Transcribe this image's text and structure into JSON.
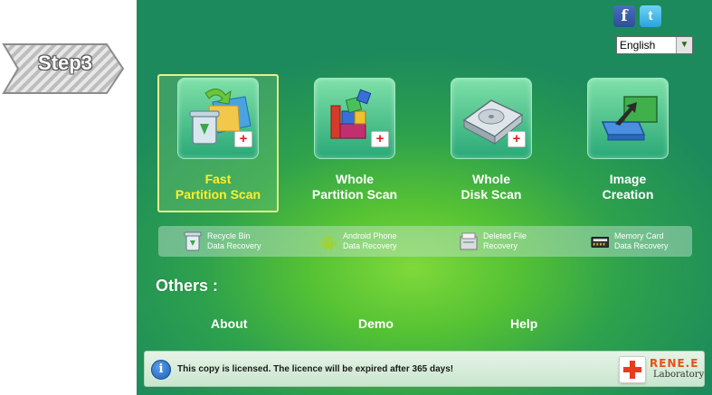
{
  "step_badge": {
    "label": "Step3"
  },
  "social": {
    "facebook": "f",
    "twitter": "t"
  },
  "language": {
    "selected": "English",
    "arrow": "▼"
  },
  "tiles": [
    {
      "line1": "Fast",
      "line2": "Partition Scan",
      "selected": true
    },
    {
      "line1": "Whole",
      "line2": "Partition Scan"
    },
    {
      "line1": "Whole",
      "line2": "Disk Scan"
    },
    {
      "line1": "Image",
      "line2": "Creation"
    }
  ],
  "recovery_bar": [
    {
      "line1": "Recycle Bin",
      "line2": "Data Recovery",
      "icon": "recycle-bin-icon"
    },
    {
      "line1": "Android Phone",
      "line2": "Data Recovery",
      "icon": "android-icon"
    },
    {
      "line1": "Deleted File",
      "line2": "Recovery",
      "icon": "deleted-file-icon"
    },
    {
      "line1": "Memory Card",
      "line2": "Data Recovery",
      "icon": "memory-card-icon"
    }
  ],
  "others": {
    "heading": "Others :",
    "about": "About",
    "demo": "Demo",
    "help": "Help"
  },
  "status": {
    "info": "i",
    "message": "This copy is licensed. The licence will be expired after 365 days!"
  },
  "brand": {
    "name": "RENE.E",
    "sub": "Laboratory"
  },
  "colors": {
    "selected_label": "#ffef2a",
    "brand_orange": "#e65216",
    "plus_red": "#e02020"
  }
}
